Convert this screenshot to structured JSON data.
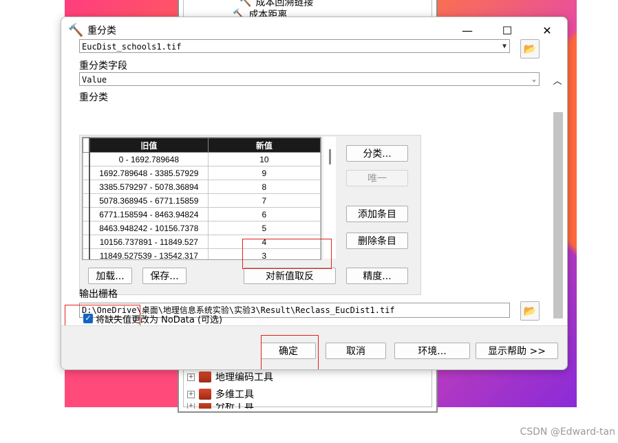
{
  "background": {
    "tree_items": [
      {
        "label": "成本回溯链接"
      },
      {
        "label": "成本距离"
      },
      {
        "label": "地理编码工具"
      },
      {
        "label": "多维工具"
      },
      {
        "label": "分析工具"
      }
    ],
    "watermark": "CSDN @Edward-tan"
  },
  "dialog": {
    "title": "重分类",
    "title_icon": "hammer-icon",
    "window_buttons": {
      "minimize": "—",
      "maximize": "☐",
      "close": "✕"
    },
    "input_raster_value": "EucDist_schools1.tif",
    "reclass_field_label": "重分类字段",
    "reclass_field_value": "Value",
    "reclass_label": "重分类",
    "table": {
      "headers": [
        "旧值",
        "新值"
      ],
      "rows": [
        {
          "old": "0 - 1692.789648",
          "new": "10"
        },
        {
          "old": "1692.789648 - 3385.57929",
          "new": "9"
        },
        {
          "old": "3385.579297 - 5078.36894",
          "new": "8"
        },
        {
          "old": "5078.368945 - 6771.15859",
          "new": "7"
        },
        {
          "old": "6771.158594 - 8463.94824",
          "new": "6"
        },
        {
          "old": "8463.948242 - 10156.7378",
          "new": "5"
        },
        {
          "old": "10156.737891 - 11849.527",
          "new": "4"
        },
        {
          "old": "11849.527539 - 13542.317",
          "new": "3"
        }
      ]
    },
    "side_buttons": {
      "classify": "分类...",
      "unique": "唯一",
      "add_entry": "添加条目",
      "delete_entry": "删除条目",
      "precision": "精度..."
    },
    "bottom_buttons": {
      "load": "加载...",
      "save": "保存...",
      "reverse": "对新值取反"
    },
    "output_label": "输出栅格",
    "output_value": "D:\\OneDrive\\桌面\\地理信息系统实验\\实验3\\Result\\Reclass_EucDist1.tif",
    "nodata_checkbox": {
      "label": "将缺失值更改为 NoData (可选)",
      "checked": true
    },
    "footer_buttons": {
      "ok": "确定",
      "cancel": "取消",
      "environments": "环境...",
      "show_help": "显示帮助 >>"
    }
  },
  "highlight_color": "#e0201b"
}
